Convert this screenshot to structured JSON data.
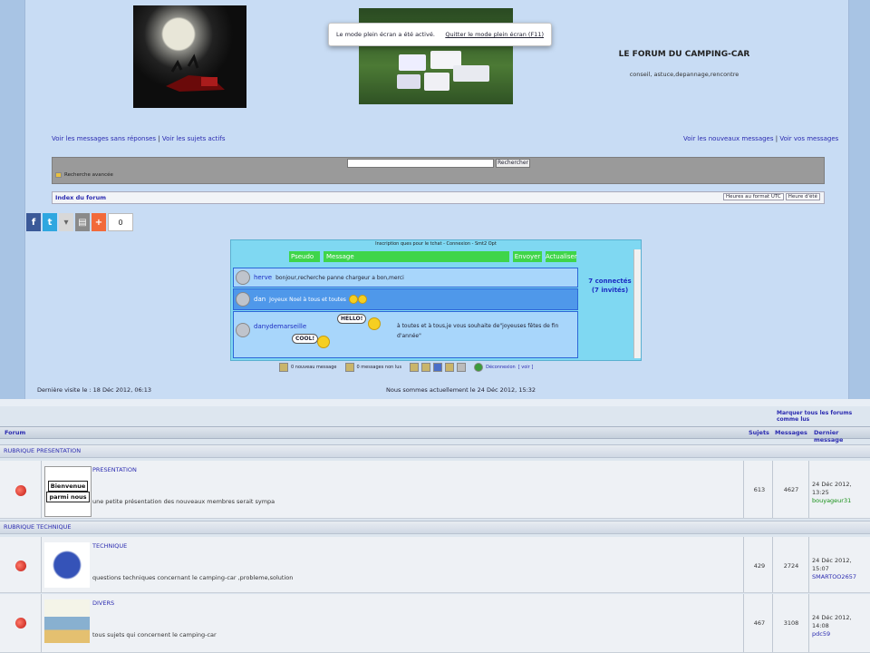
{
  "header": {
    "site_title": "LE FORUM DU CAMPING-CAR",
    "site_desc": "conseil, astuce,depannage,rencontre"
  },
  "toast": {
    "message": "Le mode plein écran a été activé.",
    "quit": "Quitter le mode plein écran (F11)"
  },
  "nav": {
    "unanswered": "Voir les messages sans réponses",
    "sep": " | ",
    "active": "Voir les sujets actifs",
    "new_msgs": "Voir les nouveaux messages",
    "your_msgs": "Voir vos messages"
  },
  "search": {
    "button": "Rechercher",
    "advanced": "Recherche avancée"
  },
  "breadcrumb": {
    "index": "Index du forum",
    "tz_utc": "Heures au format UTC",
    "tz_summer": "Heure d'été"
  },
  "social": {
    "count": "0"
  },
  "chat": {
    "header": "Inscription ques pour le tchat - Connexion - Smt2 Opt",
    "pseudo": "Pseudo",
    "message": "Message",
    "send": "Envoyer",
    "refresh": "Actualiser",
    "online_line1": "7 connectés",
    "online_line2": "(7 invités)",
    "rows": [
      {
        "user": "herve",
        "text": "bonjour,recherche panne chargeur a bon,merci"
      },
      {
        "user": "dan",
        "text": "Joyeux Noel à tous et toutes"
      },
      {
        "user": "danydemarseille",
        "text": "à toutes et à tous,je vous souhaite de\"joyeuses fêtes de fin d'année\"",
        "bubble1": "HELLO!",
        "bubble2": "COOL!"
      }
    ],
    "footer_new": "0 nouveau message",
    "footer_unread": "0 messages non lus",
    "footer_logout": "Déconnexion",
    "footer_see": "[ voir ]"
  },
  "times": {
    "last_visit": "Dernière visite le : 18 Déc 2012, 06:13",
    "now": "Nous sommes actuellement le 24 Déc 2012, 15:32"
  },
  "forum": {
    "mark_all": "Marquer tous les forums comme lus",
    "col_forum": "Forum",
    "col_topics": "Sujets",
    "col_posts": "Messages",
    "col_last": "Dernier message",
    "cat1": "RUBRIQUE PRESENTATION",
    "cat2": "RUBRIQUE TECHNIQUE",
    "forums": [
      {
        "name": "PRESENTATION",
        "desc": "une petite présentation des nouveaux membres serait sympa",
        "topics": "613",
        "posts": "4627",
        "last_date": "24 Déc 2012, 13:25",
        "last_user": "bouyageur31"
      },
      {
        "name": "TECHNIQUE",
        "desc": "questions techniques concernant le camping-car ,probleme,solution",
        "topics": "429",
        "posts": "2724",
        "last_date": "24 Déc 2012, 15:07",
        "last_user": "SMARTOO2657"
      },
      {
        "name": "DIVERS",
        "desc": "tous sujets qui concernent le camping-car",
        "topics": "467",
        "posts": "3108",
        "last_date": "24 Déc 2012, 14:08",
        "last_user": "pdc59"
      }
    ],
    "welcome_lines": [
      "Bienvenue",
      "parmi nous"
    ]
  }
}
